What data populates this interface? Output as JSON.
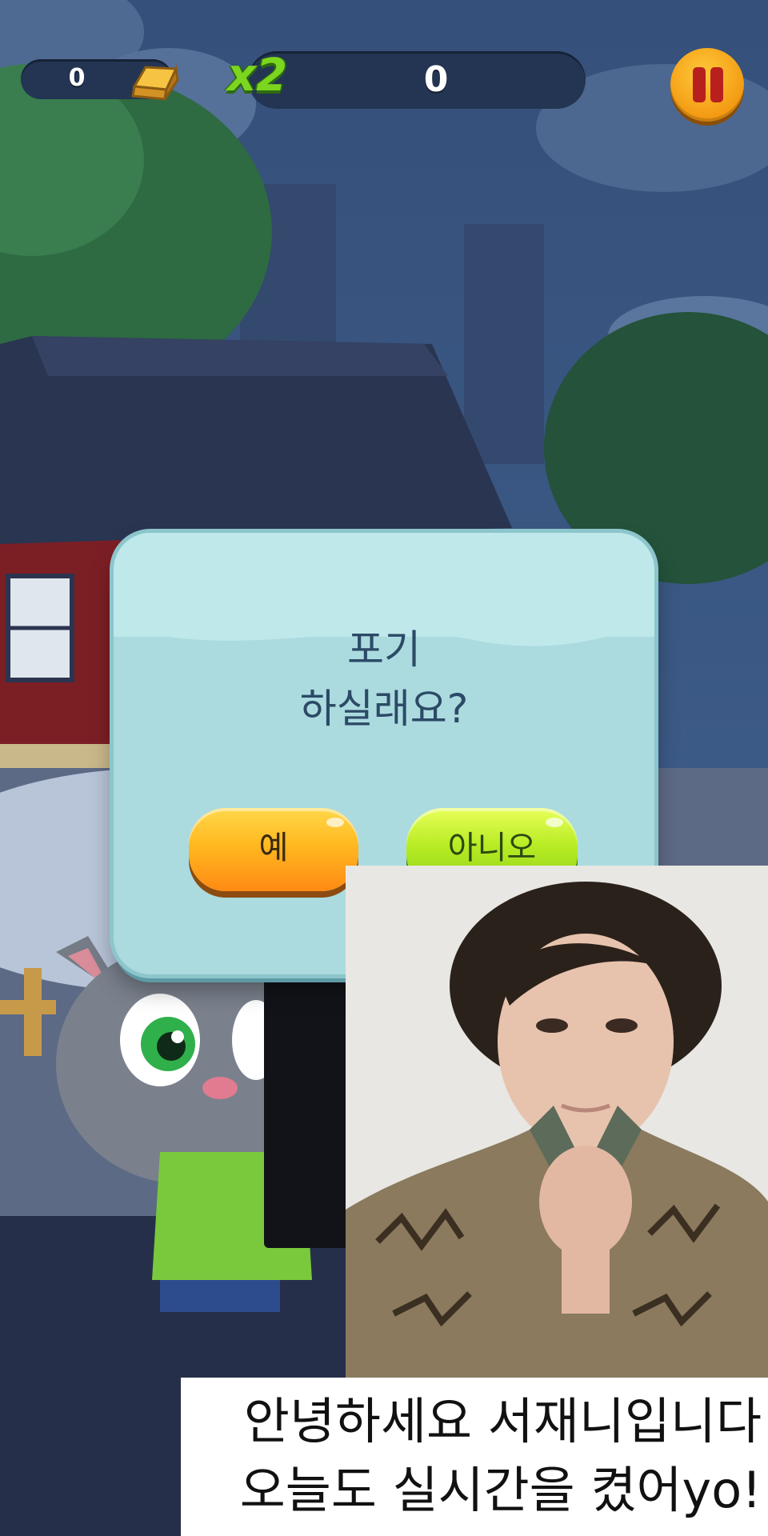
{
  "hud": {
    "gold_count": "0",
    "gold_icon": "gold-bar-icon",
    "multiplier": "x2",
    "score": "0",
    "pause_icon": "pause-icon"
  },
  "dialog": {
    "title_line1": "포기",
    "title_line2": "하실래요?",
    "yes_label": "예",
    "no_label": "아니오"
  },
  "caption": {
    "line1": "안녕하세요 서재니입니다",
    "line2": "오늘도 실시간을 켰어yo!"
  },
  "colors": {
    "dialog_bg": "#abdbdf",
    "yes_button": "#ffb820",
    "no_button": "#b8ec24",
    "multiplier": "#7cd61f",
    "pause_button": "#f39a12"
  }
}
